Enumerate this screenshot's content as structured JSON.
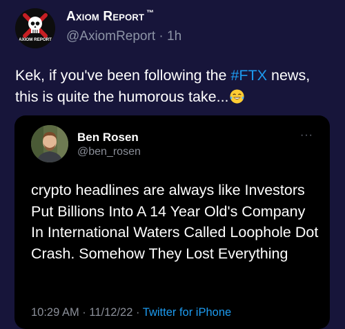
{
  "tweet": {
    "author_name": "Axiom Report",
    "trademark": "™",
    "handle": "@AxiomReport",
    "separator": " · ",
    "time": "1h",
    "text_before": "Kek, if you've been following the ",
    "hashtag": "#FTX",
    "text_after": " news, this is quite the humorous take...",
    "emoji": "face-with-tears-of-joy-icon",
    "logo_text": "AXIOM REPORT"
  },
  "quote": {
    "author_name": "Ben Rosen",
    "handle": "@ben_rosen",
    "more": "···",
    "text": "crypto headlines are always like Investors Put Billions Into A 14 Year Old's Company In International Waters Called Loophole Dot Crash. Somehow They Lost Everything",
    "time": "10:29 AM",
    "separator": " · ",
    "date": "11/12/22",
    "separator2": " · ",
    "source": "Twitter for iPhone"
  },
  "colors": {
    "background": "#17153a",
    "card": "#000000",
    "accent": "#1d9bf0",
    "muted": "#8b8f99"
  }
}
